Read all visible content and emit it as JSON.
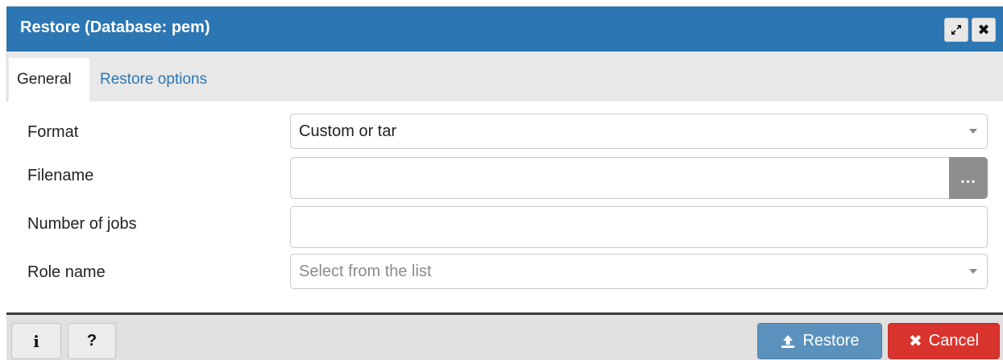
{
  "dialog": {
    "title": "Restore (Database: pem)",
    "maximize_icon": "expand-arrows-icon",
    "close_icon": "close-icon",
    "close_glyph": "✖"
  },
  "tabs": [
    {
      "label": "General",
      "active": true
    },
    {
      "label": "Restore options",
      "active": false
    }
  ],
  "form": {
    "format": {
      "label": "Format",
      "value": "Custom or tar"
    },
    "filename": {
      "label": "Filename",
      "value": "",
      "browse_label": "..."
    },
    "jobs": {
      "label": "Number of jobs",
      "value": ""
    },
    "role": {
      "label": "Role name",
      "placeholder": "Select from the list"
    }
  },
  "footer": {
    "info_label": "i",
    "help_label": "?",
    "restore_label": "Restore",
    "cancel_label": "Cancel",
    "cancel_icon_glyph": "✖",
    "restore_icon": "upload-icon"
  },
  "colors": {
    "titlebar": "#2c76b3",
    "restore_button": "#5b91bd",
    "cancel_button": "#d9332e",
    "link": "#2c76b3"
  }
}
